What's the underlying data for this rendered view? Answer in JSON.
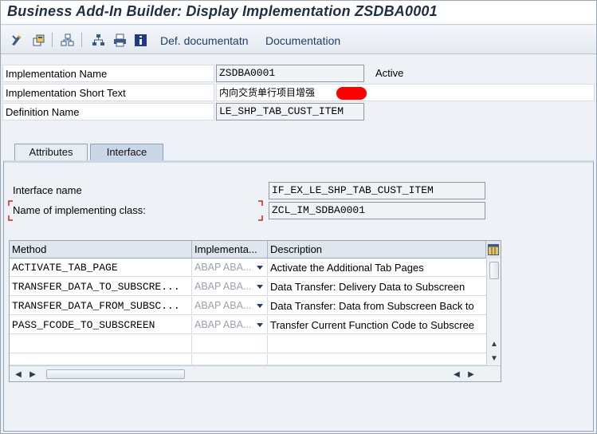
{
  "window": {
    "title": "Business Add-In Builder: Display Implementation ZSDBA0001"
  },
  "toolbar": {
    "icons": [
      "display-change-icon",
      "other-object-icon",
      "where-used-icon",
      "hierarchy-icon",
      "print-icon",
      "info-icon"
    ],
    "def_documentation_label": "Def. documentatn",
    "documentation_label": "Documentation"
  },
  "header": {
    "implementation_name_label": "Implementation Name",
    "implementation_name_value": "ZSDBA0001",
    "status": "Active",
    "short_text_label": "Implementation Short Text",
    "short_text_value": "内向交货单行项目增强",
    "definition_name_label": "Definition Name",
    "definition_name_value": "LE_SHP_TAB_CUST_ITEM"
  },
  "tabs": [
    {
      "label": "Attributes",
      "active": false
    },
    {
      "label": "Interface",
      "active": true
    }
  ],
  "interface": {
    "interface_name_label": "Interface name",
    "interface_name_value": "IF_EX_LE_SHP_TAB_CUST_ITEM",
    "impl_class_label": "Name of implementing class:",
    "impl_class_value": "ZCL_IM_SDBA0001"
  },
  "methods_table": {
    "columns": [
      "Method",
      "Implementa...",
      "Description"
    ],
    "rows": [
      {
        "method": "ACTIVATE_TAB_PAGE",
        "impl": "ABAP ABA...",
        "description": "Activate the Additional Tab Pages"
      },
      {
        "method": "TRANSFER_DATA_TO_SUBSCRE...",
        "impl": "ABAP ABA...",
        "description": "Data Transfer: Delivery Data to Subscreen"
      },
      {
        "method": "TRANSFER_DATA_FROM_SUBSC...",
        "impl": "ABAP ABA...",
        "description": "Data Transfer: Data from Subscreen Back to"
      },
      {
        "method": "PASS_FCODE_TO_SUBSCREEN",
        "impl": "ABAP ABA...",
        "description": "Transfer Current Function Code to Subscree"
      }
    ],
    "empty_rows": 3
  },
  "colors": {
    "title": "#1f2f44",
    "toolbar_link": "#1f3f66",
    "tab_active": "#c9d7e6",
    "redaction": "#ff0000"
  }
}
